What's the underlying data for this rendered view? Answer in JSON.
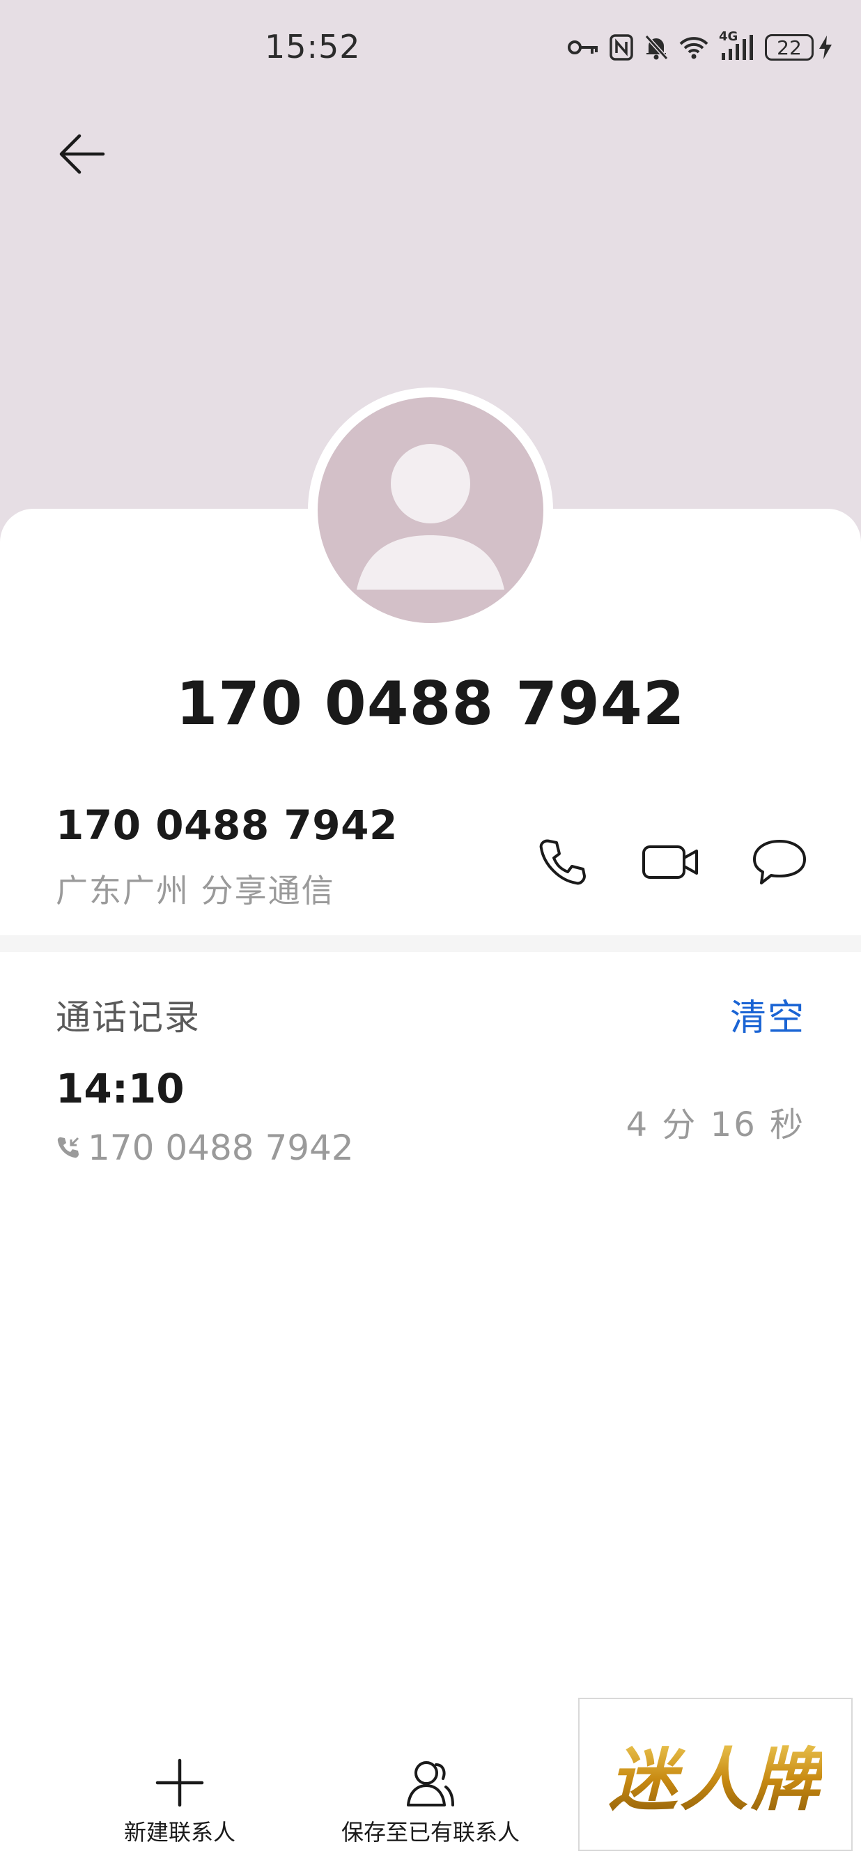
{
  "status_bar": {
    "time": "15:52",
    "network": "4G",
    "battery": "22"
  },
  "contact": {
    "title": "170 0488 7942",
    "number": "170 0488 7942",
    "location": "广东广州 分享通信"
  },
  "call_log": {
    "section_title": "通话记录",
    "clear_label": "清空",
    "entries": [
      {
        "time": "14:10",
        "number": "170 0488 7942",
        "duration": "4 分 16 秒"
      }
    ]
  },
  "bottom_actions": {
    "new_contact": "新建联系人",
    "save_existing": "保存至已有联系人"
  },
  "watermark": {
    "text": "迷人牌"
  },
  "colors": {
    "header_bg": "#e6dee4",
    "avatar_bg": "#d3c0c8",
    "accent": "#1a64d4"
  }
}
